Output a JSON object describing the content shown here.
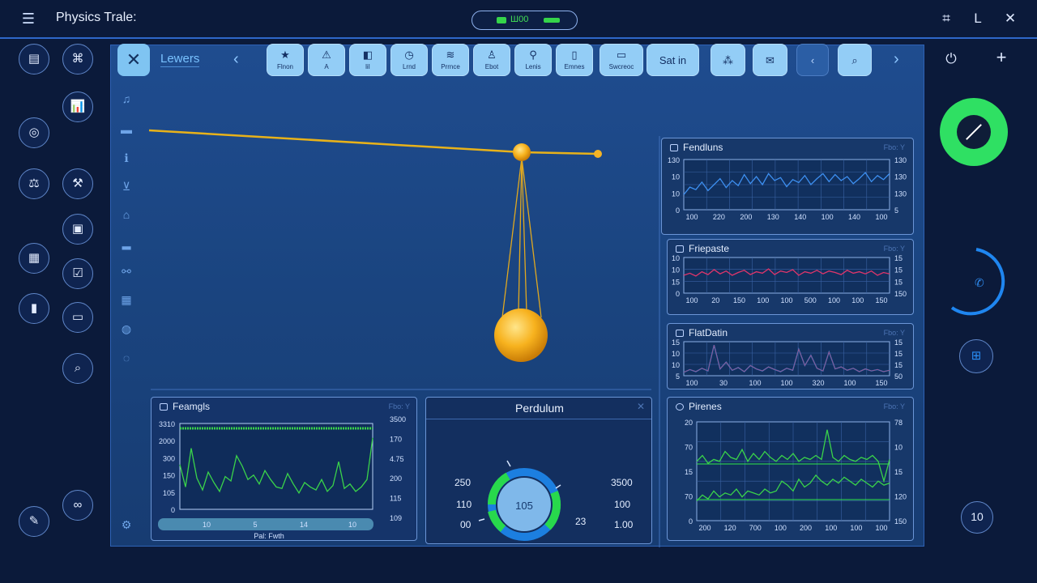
{
  "app": {
    "title": "Physics Trale:",
    "status_text": "Ш00"
  },
  "toolbar": {
    "panel_title": "Lewers",
    "tools": [
      {
        "label": "Flnon",
        "icon": "star-icon"
      },
      {
        "label": "A",
        "icon": "triangle-icon"
      },
      {
        "label": "liI",
        "icon": "tag-icon"
      },
      {
        "label": "Lrnd",
        "icon": "clock-icon"
      },
      {
        "label": "Prrnce",
        "icon": "wave-icon"
      },
      {
        "label": "Ebot",
        "icon": "figure-icon"
      },
      {
        "label": "Lenis",
        "icon": "pin-icon"
      },
      {
        "label": "Emnes",
        "icon": "doc-icon"
      },
      {
        "label": "Swcreoc",
        "icon": "screen-icon"
      }
    ],
    "set_in_label": "Sat in"
  },
  "panels": {
    "pendulums": {
      "title": "Fendluns",
      "hint": "Fbo: Y",
      "y_left": [
        "130",
        "10",
        "10",
        "0"
      ],
      "y_right": [
        "130",
        "130",
        "130",
        "5"
      ],
      "x_ticks": [
        "100",
        "220",
        "200",
        "130",
        "140",
        "100",
        "140",
        "100"
      ],
      "color": "#3d8ff0",
      "values": [
        30,
        45,
        40,
        55,
        38,
        50,
        62,
        44,
        58,
        48,
        70,
        52,
        66,
        50,
        72,
        58,
        64,
        46,
        60,
        54,
        68,
        50,
        62,
        72,
        56,
        70,
        58,
        66,
        52,
        62,
        74,
        56,
        68,
        60,
        72
      ]
    },
    "friepaste": {
      "title": "Friepaste",
      "hint": "Fbo: Y",
      "y_left": [
        "10",
        "10",
        "15",
        "0"
      ],
      "y_right": [
        "15",
        "15",
        "15",
        "150"
      ],
      "x_ticks": [
        "100",
        "20",
        "150",
        "100",
        "100",
        "500",
        "100",
        "100",
        "150"
      ],
      "color": "#e0356a",
      "values": [
        50,
        56,
        48,
        60,
        52,
        66,
        54,
        62,
        50,
        58,
        64,
        52,
        60,
        56,
        68,
        52,
        62,
        58,
        66,
        50,
        60,
        56,
        64,
        54,
        62,
        58,
        52,
        64,
        56,
        60,
        54,
        62,
        50,
        58,
        54
      ]
    },
    "fpadlatin": {
      "title": "FlatDatin",
      "hint": "Fbo: Y",
      "y_left": [
        "15",
        "10",
        "10",
        "5"
      ],
      "y_right": [
        "15",
        "15",
        "15",
        "50"
      ],
      "x_ticks": [
        "100",
        "30",
        "100",
        "100",
        "320",
        "100",
        "150"
      ],
      "color": "#3d8ff0",
      "values": [
        10,
        18,
        12,
        22,
        14,
        90,
        20,
        40,
        16,
        24,
        12,
        30,
        20,
        14,
        26,
        18,
        12,
        22,
        16,
        78,
        30,
        60,
        22,
        14,
        70,
        20,
        26,
        16,
        22,
        12,
        20,
        14,
        18,
        12,
        16
      ]
    },
    "pirenes": {
      "title": "Pirenes",
      "hint": "Fbo: Y",
      "y_left": [
        "20",
        "70",
        "15",
        "70",
        "0"
      ],
      "y_right": [
        "78",
        "10",
        "15",
        "120",
        "150"
      ],
      "x_ticks": [
        "200",
        "120",
        "700",
        "100",
        "200",
        "100",
        "100",
        "100"
      ],
      "series_a": [
        60,
        66,
        58,
        62,
        60,
        70,
        64,
        62,
        72,
        60,
        68,
        62,
        70,
        64,
        60,
        66,
        62,
        68,
        60,
        64,
        62,
        66,
        62,
        92,
        64,
        60,
        66,
        62,
        60,
        64,
        62,
        66,
        60,
        40,
        62
      ],
      "series_b": [
        20,
        26,
        22,
        30,
        24,
        28,
        26,
        32,
        24,
        30,
        28,
        26,
        32,
        28,
        30,
        40,
        36,
        30,
        42,
        34,
        38,
        46,
        40,
        36,
        42,
        38,
        44,
        40,
        36,
        42,
        38,
        34,
        40,
        36,
        38
      ]
    },
    "feamgls": {
      "title": "Feamgls",
      "hint": "Fbo: Y",
      "y_left": [
        "3310",
        "2000",
        "300",
        "150",
        "105",
        "0"
      ],
      "y_right": [
        "3500",
        "170",
        "4.75",
        "200",
        "115",
        "109"
      ],
      "x_ticks": [
        "10",
        "5",
        "14",
        "10"
      ],
      "footer": "Pal: Fwth",
      "color": "#3ad34a",
      "values": [
        60,
        30,
        82,
        42,
        26,
        50,
        36,
        24,
        44,
        38,
        72,
        58,
        40,
        46,
        34,
        52,
        40,
        30,
        28,
        48,
        34,
        22,
        36,
        30,
        26,
        40,
        24,
        32,
        64,
        28,
        34,
        24,
        30,
        40,
        96
      ]
    },
    "perdulum": {
      "title": "Perdulum",
      "center_value": "105",
      "left_values": [
        "250",
        "110",
        "00"
      ],
      "right_values": [
        "3500",
        "100",
        "1.00"
      ],
      "gauge_labels": [
        "23"
      ]
    }
  },
  "right": {
    "counter": "10"
  }
}
